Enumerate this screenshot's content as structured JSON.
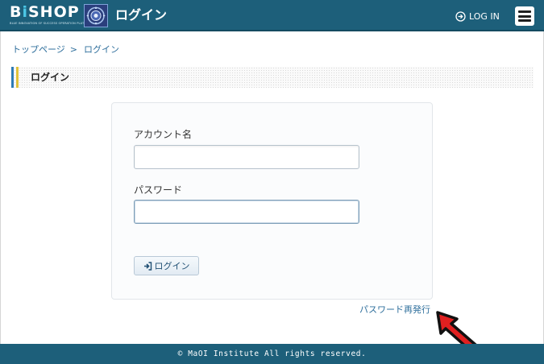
{
  "header": {
    "logo_text_pre": "B",
    "logo_text_accent": "i",
    "logo_text_post": "SHOP",
    "logo_subtitle": "BLUE INNOVATION OF SUCCESS OPERATION PLATFORM",
    "page_title": "ログイン",
    "login_label": "LOG IN",
    "colors": {
      "bar": "#1d5f7a",
      "accent": "#4cc7e6"
    }
  },
  "breadcrumb": {
    "home": "トップページ",
    "separator": ">",
    "current": "ログイン"
  },
  "section": {
    "title": "ログイン"
  },
  "form": {
    "account_label": "アカウント名",
    "account_value": "",
    "password_label": "パスワード",
    "password_value": "",
    "submit_label": "ログイン"
  },
  "links": {
    "password_reset": "パスワード再発行"
  },
  "footer": {
    "copyright": "© MaOI Institute All rights reserved."
  },
  "icons": {
    "login": "login-arrow-icon",
    "menu": "hamburger-menu-icon",
    "annotation": "red-arrow-icon"
  }
}
